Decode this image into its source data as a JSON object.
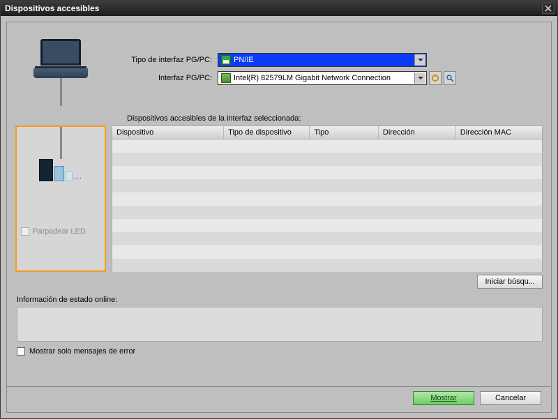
{
  "window": {
    "title": "Dispositivos accesibles"
  },
  "form": {
    "interface_type_label": "Tipo de interfaz PG/PC:",
    "interface_type_value": "PN/IE",
    "interface_label": "Interfaz PG/PC:",
    "interface_value": "Intel(R) 82579LM Gigabit Network Connection"
  },
  "mid": {
    "caption": "Dispositivos accesibles de la interfaz seleccionada:",
    "blink_led_label": "Parpadear LED",
    "columns": [
      "Dispositivo",
      "Tipo de dispositivo",
      "Tipo",
      "Dirección",
      "Dirección MAC"
    ]
  },
  "search_button": "Iniciar búsqu...",
  "status": {
    "label": "Información de estado online:",
    "errors_only_label": "Mostrar solo mensajes de error"
  },
  "footer": {
    "show": "Mostrar",
    "cancel": "Cancelar"
  }
}
